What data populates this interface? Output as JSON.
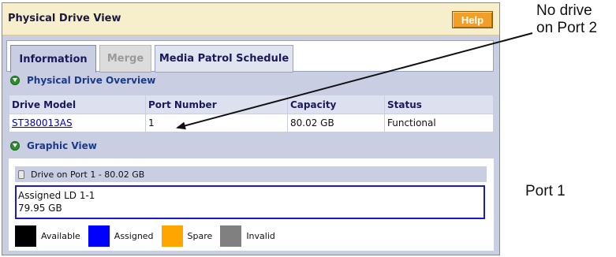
{
  "panel": {
    "title": "Physical Drive View",
    "help_label": "Help"
  },
  "tabs": [
    {
      "label": "Information",
      "state": "active"
    },
    {
      "label": "Merge",
      "state": "disabled"
    },
    {
      "label": "Media Patrol Schedule",
      "state": "normal"
    }
  ],
  "overview": {
    "heading": "Physical Drive Overview",
    "columns": [
      "Drive Model",
      "Port Number",
      "Capacity",
      "Status"
    ],
    "rows": [
      {
        "drive_model": "ST380013AS",
        "port_number": "1",
        "capacity": "80.02 GB",
        "status": "Functional"
      }
    ]
  },
  "graphic": {
    "heading": "Graphic View",
    "drive_label": "Drive on Port 1 - 80.02 GB",
    "assigned_line1": "Assigned LD 1-1",
    "assigned_line2": "79.95 GB",
    "legend": [
      {
        "label": "Available",
        "color": "#000000"
      },
      {
        "label": "Assigned",
        "color": "#0000ff"
      },
      {
        "label": "Spare",
        "color": "#ffa500"
      },
      {
        "label": "Invalid",
        "color": "#808080"
      }
    ]
  },
  "annotations": {
    "no_drive_line1": "No drive",
    "no_drive_line2": "on Port 2",
    "port1": "Port 1"
  },
  "colors": {
    "accent_orange": "#f0a028",
    "panel_bg": "#c9cee3",
    "header_bg": "#f7eecb",
    "section_text": "#1a3a8a"
  }
}
